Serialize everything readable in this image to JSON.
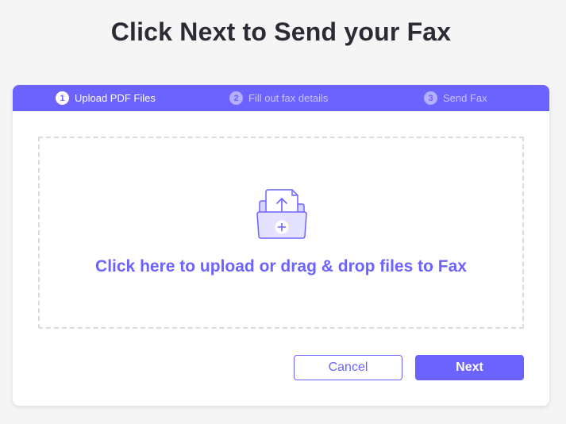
{
  "page": {
    "title": "Click Next to Send your Fax"
  },
  "steps": [
    {
      "number": "1",
      "label": "Upload PDF Files",
      "state": "active"
    },
    {
      "number": "2",
      "label": "Fill out fax details",
      "state": "inactive"
    },
    {
      "number": "3",
      "label": "Send Fax",
      "state": "inactive"
    }
  ],
  "dropzone": {
    "text": "Click here to upload or drag & drop files to Fax",
    "icon": "folder-upload-icon"
  },
  "buttons": {
    "cancel_label": "Cancel",
    "next_label": "Next"
  },
  "colors": {
    "accent": "#6c63ff",
    "title": "#2b2b36",
    "background": "#f5f5f5"
  }
}
